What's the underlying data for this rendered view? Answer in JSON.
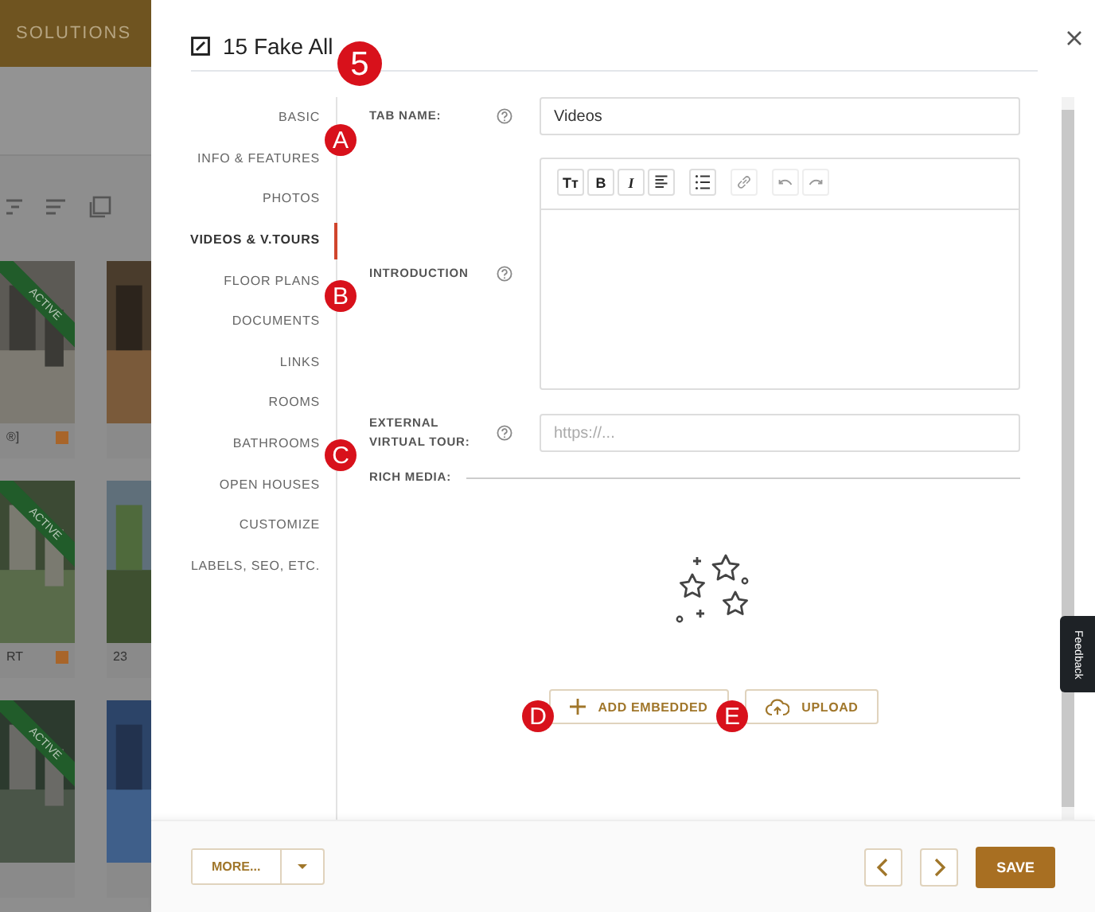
{
  "background": {
    "brand_tab": "SOLUTIONS",
    "cards": [
      {
        "ribbon": "ACTIVE",
        "caption": "®]",
        "tag": true
      },
      {
        "tag": false
      },
      {
        "ribbon": "ACTIVE",
        "caption": "RT",
        "tag": true
      },
      {
        "caption": "23",
        "tag": false
      },
      {
        "ribbon": "ACTIVE",
        "tag": false
      },
      {
        "tag": false
      }
    ]
  },
  "modal": {
    "title": "15 Fake All",
    "nav": [
      {
        "label": "BASIC",
        "selected": false
      },
      {
        "label": "INFO & FEATURES",
        "selected": false
      },
      {
        "label": "PHOTOS",
        "selected": false
      },
      {
        "label": "VIDEOS & V.TOURS",
        "selected": true
      },
      {
        "label": "FLOOR PLANS",
        "selected": false
      },
      {
        "label": "DOCUMENTS",
        "selected": false
      },
      {
        "label": "LINKS",
        "selected": false
      },
      {
        "label": "ROOMS",
        "selected": false
      },
      {
        "label": "BATHROOMS",
        "selected": false
      },
      {
        "label": "OPEN HOUSES",
        "selected": false
      },
      {
        "label": "CUSTOMIZE",
        "selected": false
      },
      {
        "label": "LABELS, SEO, ETC.",
        "selected": false
      }
    ],
    "fields": [
      {
        "kind": "input",
        "label": "TAB NAME:",
        "value": "Videos"
      },
      {
        "kind": "editor",
        "label": "INTRODUCTION",
        "toolbar": [
          {
            "kind": "text-size",
            "glyph": "Tт"
          },
          {
            "kind": "bold",
            "glyph": "B"
          },
          {
            "kind": "italic",
            "glyph": "I"
          },
          {
            "kind": "align"
          },
          {
            "kind": "list"
          },
          {
            "kind": "link"
          },
          {
            "kind": "undo"
          },
          {
            "kind": "redo"
          }
        ]
      },
      {
        "kind": "input",
        "label": "EXTERNAL VIRTUAL TOUR:",
        "placeholder": "https://..."
      }
    ],
    "rich_media": {
      "label": "RICH MEDIA:",
      "buttons": [
        {
          "kind": "add",
          "label": "ADD EMBEDDED"
        },
        {
          "kind": "upload",
          "label": "UPLOAD"
        }
      ]
    },
    "footer": {
      "more": "MORE...",
      "save": "SAVE"
    }
  },
  "feedback_tab": "Feedback",
  "annotations": [
    {
      "label": "5"
    },
    {
      "label": "A"
    },
    {
      "label": "B"
    },
    {
      "label": "C"
    },
    {
      "label": "D"
    },
    {
      "label": "E"
    }
  ]
}
